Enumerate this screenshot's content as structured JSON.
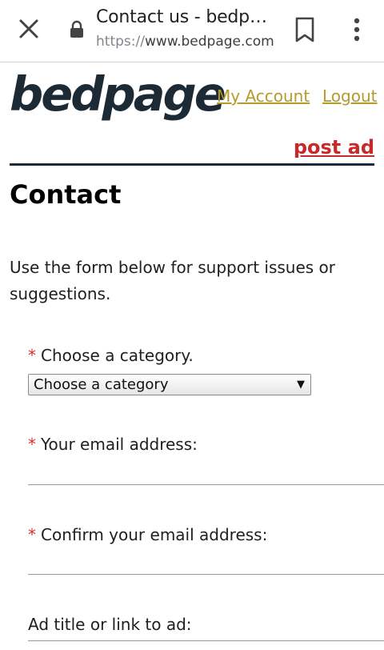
{
  "browser": {
    "title": "Contact us - bedp…",
    "url_scheme": "https://",
    "url_host": "www.bedpage.com",
    "icons": {
      "close": "close-icon",
      "lock": "lock-icon",
      "bookmark": "bookmark-icon",
      "menu": "more-vert-icon"
    }
  },
  "site": {
    "logo": "bedpage",
    "my_account": "My Account ",
    "logout": "Logout",
    "post_ad": "post ad"
  },
  "page": {
    "heading": "Contact",
    "intro": "Use the form below for support issues or suggestions."
  },
  "form": {
    "required_mark": "*",
    "category_label": "Choose a category.",
    "category_selected": "Choose a category",
    "email_label": "Your email address:",
    "email_value": "",
    "confirm_label": "Confirm your email address:",
    "confirm_value": "",
    "adtitle_label": "Ad title or link to ad:",
    "adtitle_value": ""
  },
  "colors": {
    "link": "#b59a2c",
    "post_ad": "#c62a2a",
    "logo": "#1c2a36",
    "required": "#d3302f"
  }
}
